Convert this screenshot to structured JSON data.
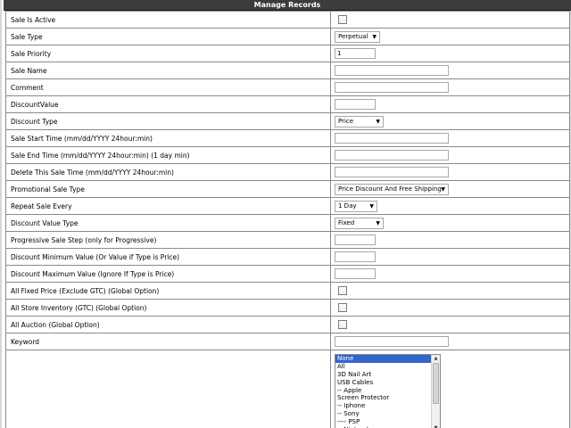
{
  "title": "Manage Records",
  "fields": {
    "sale_is_active": {
      "label": "Sale Is Active"
    },
    "sale_type": {
      "label": "Sale Type",
      "value": "Perpetual"
    },
    "sale_priority": {
      "label": "Sale Priority",
      "value": "1"
    },
    "sale_name": {
      "label": "Sale Name",
      "value": ""
    },
    "comment": {
      "label": "Comment",
      "value": ""
    },
    "discount_value": {
      "label": "DiscountValue",
      "value": ""
    },
    "discount_type": {
      "label": "Discount Type",
      "value": "Price"
    },
    "sale_start_time": {
      "label": "Sale Start Time (mm/dd/YYYY 24hour:min)",
      "value": ""
    },
    "sale_end_time": {
      "label": "Sale End Time (mm/dd/YYYY 24hour:min) (1 day min)",
      "value": ""
    },
    "delete_sale_time": {
      "label": "Delete This Sale Time (mm/dd/YYYY 24hour:min)",
      "value": ""
    },
    "promotional_sale_type": {
      "label": "Promotional Sale Type",
      "value": "Price Discount And Free Shipping"
    },
    "repeat_sale_every": {
      "label": "Repeat Sale Every",
      "value": "1 Day"
    },
    "discount_value_type": {
      "label": "Discount Value Type",
      "value": "Fixed"
    },
    "progressive_sale_step": {
      "label": "Progressive Sale Step (only for Progressive)",
      "value": ""
    },
    "discount_minimum_value": {
      "label": "Discount Minimum Value (Or Value if Type is Price)",
      "value": ""
    },
    "discount_maximum_value": {
      "label": "Discount Maximum Value (Ignore If Type is Price)",
      "value": ""
    },
    "all_fixed_price": {
      "label": "All Fixed Price (Exclude GTC) (Global Option)"
    },
    "all_store_inventory": {
      "label": "All Store Inventory (GTC) (Global Option)"
    },
    "all_auction": {
      "label": "All Auction (Global Option)"
    },
    "keyword": {
      "label": "Keyword",
      "value": ""
    }
  },
  "category_list": {
    "label": "",
    "options": [
      "None",
      "All",
      "3D Nail Art",
      "USB Cables",
      "-- Apple",
      "Screen Protector",
      "-- Iphone",
      "-- Sony",
      "---- PSP",
      "-- Nintendo"
    ],
    "selected": "None"
  },
  "icons": {
    "dropdown": "chevron-down-icon",
    "scroll_up": "scroll-up-icon",
    "scroll_down": "scroll-down-icon"
  }
}
